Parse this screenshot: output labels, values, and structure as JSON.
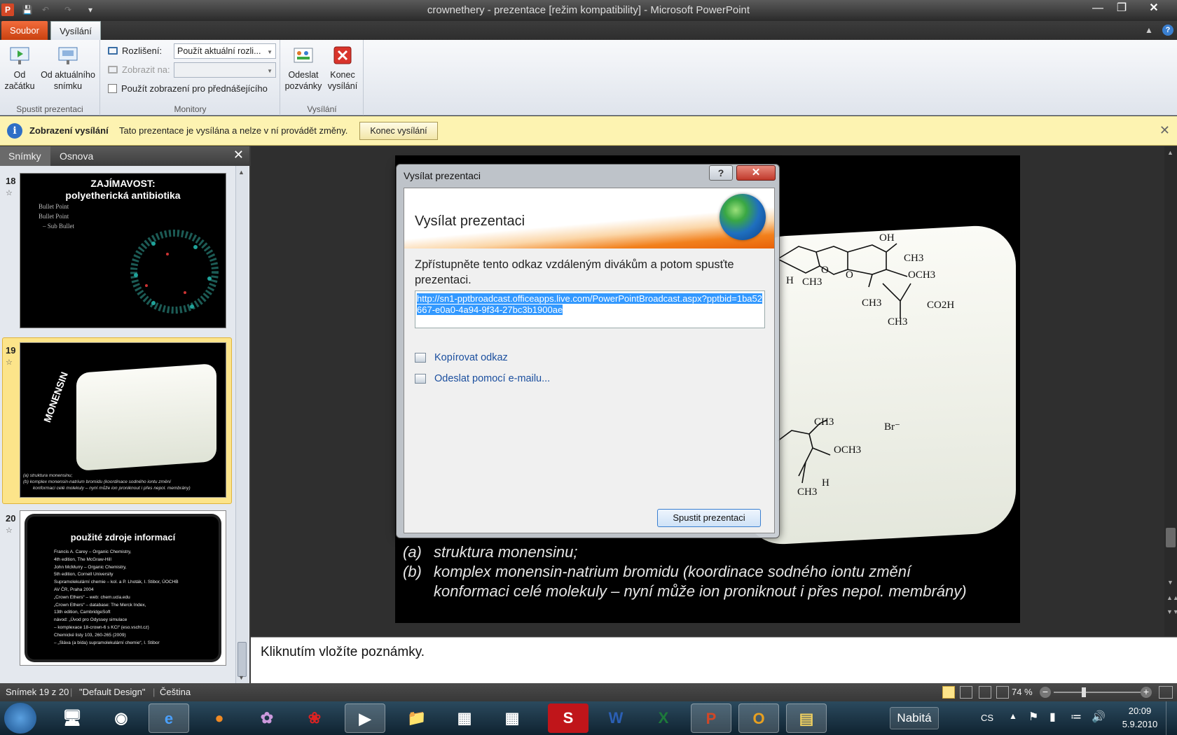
{
  "window": {
    "title": "crownethery - prezentace [režim kompatibility] - Microsoft PowerPoint"
  },
  "quick_access": {
    "app_icon": "P",
    "save_icon": "save-icon",
    "undo_icon": "undo-icon",
    "redo_icon": "redo-icon"
  },
  "menu_tabs": {
    "file": "Soubor",
    "broadcast": "Vysílání"
  },
  "ribbon": {
    "start_group": {
      "label": "Spustit prezentaci",
      "from_start_line1": "Od",
      "from_start_line2": "začátku",
      "from_current_line1": "Od aktuálního",
      "from_current_line2": "snímku"
    },
    "monitors_group": {
      "label": "Monitory",
      "resolution_label": "Rozlišení:",
      "resolution_value": "Použít aktuální rozli...",
      "show_on_label": "Zobrazit na:",
      "presenter_view_label": "Použít zobrazení pro přednášejícího"
    },
    "broadcast_group": {
      "label": "Vysílání",
      "send_invites_line1": "Odeslat",
      "send_invites_line2": "pozvánky",
      "end_line1": "Konec",
      "end_line2": "vysílání"
    }
  },
  "message_bar": {
    "title": "Zobrazení vysílání",
    "text": "Tato prezentace je vysílána a nelze v ní provádět změny.",
    "button": "Konec vysílání"
  },
  "left_pane": {
    "tabs": [
      "Snímky",
      "Osnova"
    ],
    "slides": [
      {
        "number": "18",
        "title_line1": "ZAJÍMAVOST:",
        "title_line2": "polyetherická antibiotika",
        "bullets": [
          "Bullet Point",
          "Bullet Point",
          "– Sub Bullet"
        ]
      },
      {
        "number": "19",
        "vertical_title": "MONENSIN",
        "caption_a": "(a)  struktura monensinu;",
        "caption_b": "(b)  komplex monensin-natrium bromidu (koordinace sodného iontu změní",
        "caption_b2": "konformaci celé molekuly – nyní může ion proniknout i přes nepol. membrány)"
      },
      {
        "number": "20",
        "title": "použité zdroje informací",
        "lines": [
          "Francis A. Carey – Organic Chemistry,",
          "4th edition, The McGraw-Hill",
          "John McMurry – Organic Chemistry,",
          "5th edition, Cornell University",
          "Supramolekulární chemie – kol. a P. Lhoták, I. Stibor, ÚOCHB",
          "AV ČR, Praha 2004",
          "„Crown Ethers“ – web: chem.ucla.edu",
          "„Crown Ethers“ – database: The Merck Index,",
          "13th edition, CambridgeSoft",
          "návod: „Úvod pro Odyssey simulace",
          "– komplexace 18-crown-6 s KCl“ (eso.vscht.cz)",
          "Chemické listy 103, 260-265 (2009)",
          "– „Sláva (a bída) supramolekulární chemie“, I. Stibor"
        ]
      }
    ]
  },
  "slide": {
    "caption_a_label": "(a)",
    "caption_a": "struktura monensinu;",
    "caption_b_label": "(b)",
    "caption_b_line1": "komplex monensin-natrium bromidu (koordinace sodného iontu změní",
    "caption_b_line2": "konformaci celé molekuly – nyní může ion proniknout i přes nepol. membrány)",
    "molecule_labels": {
      "oh": "OH",
      "ch3_a": "CH3",
      "och3_a": "OCH3",
      "h": "H",
      "ch3_b": "CH3",
      "o1": "O",
      "o2": "O",
      "ch3_c": "CH3",
      "co2h": "CO2H",
      "ch3_d": "CH3",
      "ch3_e": "CH3",
      "br": "Br⁻",
      "och3_b": "OCH3",
      "ch3_f": "CH3",
      "h2": "H"
    }
  },
  "dialog": {
    "window_title": "Vysílat prezentaci",
    "help": "?",
    "close": "✕",
    "heading": "Vysílat prezentaci",
    "instruction": "Zpřístupněte tento odkaz vzdáleným divákům a potom spusťte prezentaci.",
    "link": "http://sn1-pptbroadcast.officeapps.live.com/PowerPointBroadcast.aspx?pptbid=1ba52667-e0a0-4a94-9f34-27bc3b1900ae",
    "copy_link": "Kopírovat odkaz",
    "send_email": "Odeslat pomocí e-mailu...",
    "start_button": "Spustit prezentaci"
  },
  "notes": {
    "placeholder": "Kliknutím vložíte poznámky."
  },
  "status_bar": {
    "slide_info": "Snímek 19 z 20",
    "design": "\"Default Design\"",
    "language": "Čeština",
    "zoom": "74 %"
  },
  "taskbar": {
    "battery": "Nabitá",
    "language": "CS",
    "time": "20:09",
    "date": "5.9.2010"
  },
  "colors": {
    "file_tab": "#d9541e",
    "message_bar": "#fdf3b1",
    "selected_slide": "#fce48a",
    "link_highlight": "#3399ff"
  }
}
